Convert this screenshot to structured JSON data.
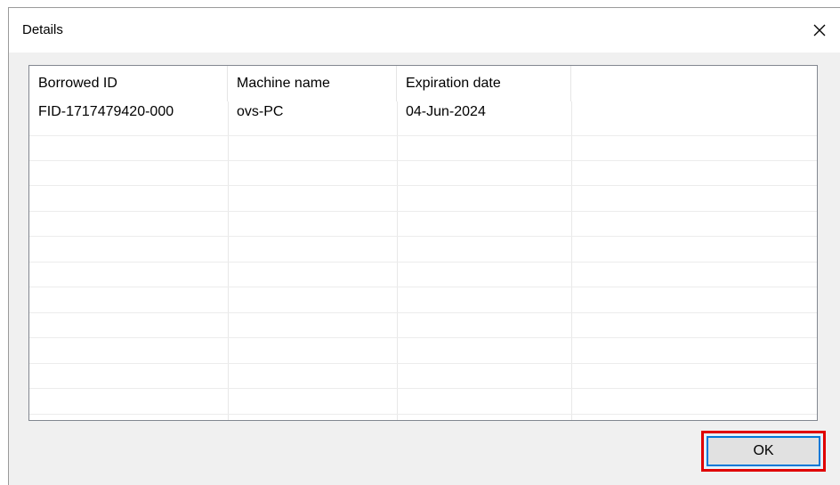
{
  "window": {
    "title": "Details",
    "close_icon": "close-icon"
  },
  "list": {
    "columns": [
      "Borrowed ID",
      "Machine name",
      "Expiration date"
    ],
    "rows": [
      [
        "FID-1717479420-000",
        "ovs-PC",
        "04-Jun-2024"
      ]
    ]
  },
  "buttons": {
    "ok_label": "OK"
  },
  "colors": {
    "highlight_border": "#e00000",
    "focus_border": "#0078d7"
  }
}
